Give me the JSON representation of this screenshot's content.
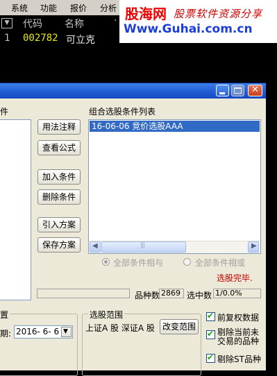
{
  "menu": [
    "系统",
    "功能",
    "报价",
    "分析"
  ],
  "watermark": {
    "logo": "股海网",
    "slogan": "股票软件资源分享",
    "url": "Www.Guhai.com.cn"
  },
  "stock_table": {
    "headers": [
      "代码",
      "名称"
    ],
    "rows": [
      {
        "index": "1",
        "code": "002782",
        "name": "可立克"
      }
    ]
  },
  "dialog": {
    "left_panel_title_fragment": "件",
    "buttons": {
      "usage_notes": "用法注释",
      "view_formula": "查看公式",
      "add_condition": "加入条件",
      "delete_condition": "删除条件",
      "import_plan": "引入方案",
      "save_plan": "保存方案",
      "change_range": "改变范围"
    },
    "condition_list": {
      "title": "组合选股条件列表",
      "items": [
        "16-06-06 竞价选股AAA"
      ]
    },
    "radios": {
      "all_and": "全部条件相与",
      "all_or": "全部条件相或"
    },
    "status": {
      "done": "选股完毕.",
      "count_label": "品种数",
      "count_value": "2869",
      "selected_label": "选中数",
      "selected_value": "1/0.0%"
    },
    "left_group": {
      "title_fragment": "置",
      "date_label_fragment": "期:",
      "date_value": "2016- 6- 6"
    },
    "range_group": {
      "title": "选股范围",
      "range_text": "上证A 股  深证A 股"
    },
    "checkboxes": {
      "prev_restore": "前复权数据",
      "exclude_untraded_line1": "剔除当前未",
      "exclude_untraded_line2": "交易的品种",
      "exclude_st": "剔除ST品种"
    },
    "colors": {
      "title_bar": "#1f5bd3",
      "selection": "#316ac5",
      "status_done": "#c00000",
      "stock_code": "#e8e800"
    }
  }
}
